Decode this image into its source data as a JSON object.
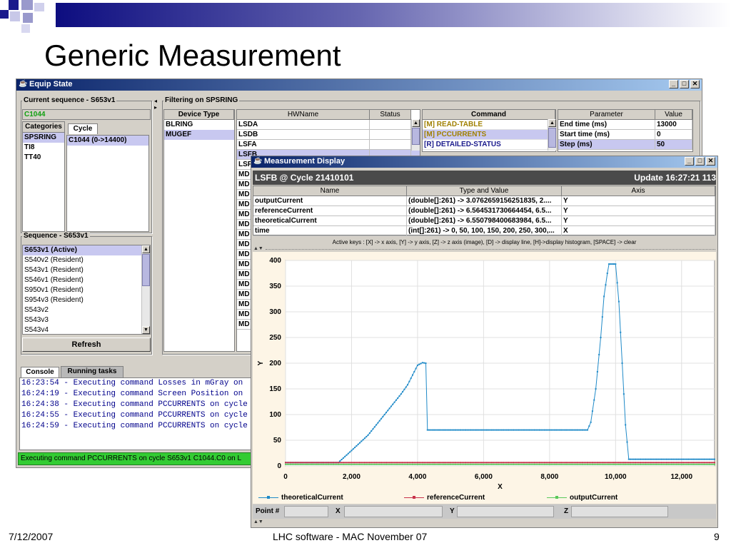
{
  "slide": {
    "title": "Generic Measurement",
    "date": "7/12/2007",
    "footer": "LHC software - MAC November 07",
    "page": "9"
  },
  "equip": {
    "title": "Equip State",
    "current_sequence_label": "Current sequence - S653v1",
    "current_cycle": "C1044",
    "categories_tab": "Categories",
    "cycle_tab": "Cycle",
    "categories": [
      "SPSRING",
      "TI8",
      "TT40"
    ],
    "cycles": [
      "C1044 (0->14400)"
    ],
    "sequence_label": "Sequence - S653v1",
    "sequences": [
      "S653v1 (Active)",
      "S540v2 (Resident)",
      "S543v1 (Resident)",
      "S546v1 (Resident)",
      "S950v1 (Resident)",
      "S954v3 (Resident)",
      "S543v2",
      "S543v3",
      "S543v4"
    ],
    "refresh_label": "Refresh",
    "filtering_label": "Filtering on SPSRING",
    "device_type_header": "Device Type",
    "device_types": [
      "BLRING",
      "MUGEF"
    ],
    "hwname_header": "HWName",
    "status_header": "Status",
    "hwnames": [
      "LSDA",
      "LSDB",
      "LSFA",
      "LSFB",
      "LSF",
      "MD",
      "MD",
      "MD",
      "MD",
      "MD",
      "MD",
      "MD",
      "MD",
      "MD",
      "MD",
      "MD",
      "MD",
      "MD",
      "MD",
      "MD",
      "MD"
    ],
    "command_header": "Command",
    "commands": [
      "[M]  READ-TABLE",
      "[M]  PCCURRENTS",
      "[R]  DETAILED-STATUS"
    ],
    "parameter_header": "Parameter",
    "value_header": "Value",
    "parameters": [
      {
        "name": "End time (ms)",
        "value": "13000"
      },
      {
        "name": "Start time (ms)",
        "value": "0"
      },
      {
        "name": "Step (ms)",
        "value": "50"
      }
    ],
    "console_tab": "Console",
    "running_tab": "Running tasks",
    "console_lines": [
      "16:23:54 - Executing command Losses in mGray on",
      "16:24:19 - Executing command Screen Position on",
      "16:24:38 - Executing command PCCURRENTS on cycle",
      "16:24:55 - Executing command PCCURRENTS on cycle",
      "16:24:59 - Executing command PCCURRENTS on cycle"
    ],
    "status_bar": "Executing command PCCURRENTS on cycle S653v1 C1044.C0 on L"
  },
  "measure": {
    "title": "Measurement Display",
    "device_info": "LSFB @ Cycle 21410101",
    "update_info": "Update 16:27:21 113",
    "col_name": "Name",
    "col_type": "Type and Value",
    "col_axis": "Axis",
    "rows": [
      {
        "name": "outputCurrent",
        "type": "(double[]:261) -> 3.0762659156251835, 2....",
        "axis": "Y"
      },
      {
        "name": "referenceCurrent",
        "type": "(double[]:261) -> 6.564531730664454, 6.5...",
        "axis": "Y"
      },
      {
        "name": "theoreticalCurrent",
        "type": "(double[]:261) -> 6.550798400683984, 6.5...",
        "axis": "Y"
      },
      {
        "name": "time",
        "type": "(int[]:261) -> 0, 50, 100, 150, 200, 250, 300,...",
        "axis": "X"
      }
    ],
    "active_keys": "Active keys :  [X] -> x axis,    [Y] -> y axis,    [Z] -> z axis (image),    [D] -> display line,    [H]->display histogram,    [SPACE] -> clear",
    "point_label": "Point #",
    "x_label": "X",
    "y_label": "Y",
    "z_label": "Z"
  },
  "chart_data": {
    "type": "line",
    "xlabel": "X",
    "ylabel": "Y",
    "xlim": [
      0,
      13000
    ],
    "ylim": [
      0,
      400
    ],
    "xticks": [
      0,
      2000,
      4000,
      6000,
      8000,
      10000,
      12000
    ],
    "xtick_labels": [
      "0",
      "2,000",
      "4,000",
      "6,000",
      "8,000",
      "10,000",
      "12,000"
    ],
    "yticks": [
      0,
      50,
      100,
      150,
      200,
      250,
      300,
      350,
      400
    ],
    "grid": true,
    "legend_position": "bottom",
    "series": [
      {
        "name": "theoreticalCurrent",
        "color": "#1f8ac8",
        "points": [
          [
            0,
            6.6
          ],
          [
            1600,
            6.6
          ],
          [
            2000,
            30
          ],
          [
            2500,
            60
          ],
          [
            3000,
            100
          ],
          [
            3500,
            140
          ],
          [
            3700,
            158
          ],
          [
            4000,
            196
          ],
          [
            4150,
            201
          ],
          [
            4250,
            200
          ],
          [
            4300,
            70
          ],
          [
            6000,
            70
          ],
          [
            8000,
            70
          ],
          [
            9150,
            70
          ],
          [
            9250,
            85
          ],
          [
            9400,
            150
          ],
          [
            9550,
            250
          ],
          [
            9650,
            330
          ],
          [
            9750,
            375
          ],
          [
            9800,
            393
          ],
          [
            9950,
            393
          ],
          [
            10000,
            393
          ],
          [
            10100,
            320
          ],
          [
            10200,
            200
          ],
          [
            10300,
            80
          ],
          [
            10400,
            13
          ],
          [
            13000,
            13
          ]
        ]
      },
      {
        "name": "referenceCurrent",
        "color": "#c8324a",
        "points": [
          [
            0,
            6.6
          ],
          [
            13000,
            6.6
          ]
        ]
      },
      {
        "name": "outputCurrent",
        "color": "#5ac85a",
        "points": [
          [
            0,
            3.1
          ],
          [
            13000,
            3.1
          ]
        ]
      }
    ]
  },
  "colors": {
    "title_bar": "#0a246a",
    "title_bar_end": "#a6caf0",
    "selection": "#c8c8f0",
    "status_green": "#33cc33",
    "header_gray": "#4a4a4a"
  }
}
